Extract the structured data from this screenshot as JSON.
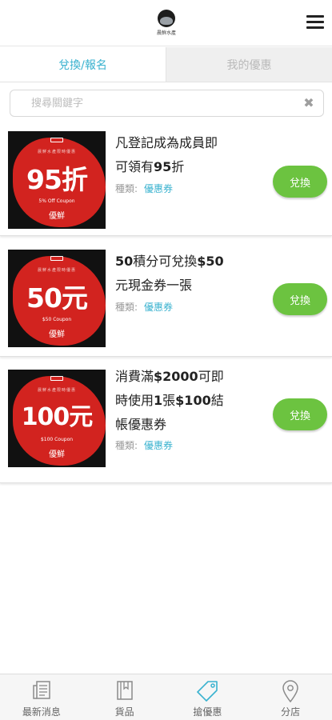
{
  "header": {
    "logo_text": "晨鮮水產",
    "menu_icon": "hamburger-icon"
  },
  "tabs": [
    {
      "label": "兌換/報名",
      "active": true
    },
    {
      "label": "我的優惠",
      "active": false
    }
  ],
  "search": {
    "placeholder": "搜尋關鍵字",
    "value": ""
  },
  "coupons": [
    {
      "image": {
        "sub": "晨鮮水產限時優惠",
        "big": "95折",
        "coupon": "5% Off Coupon",
        "brand": "優鮮"
      },
      "title": [
        "凡登記成為成員即",
        "可領有",
        "95",
        "折"
      ],
      "type_label": "種類:",
      "type_value": "優惠券",
      "button": "兌換"
    },
    {
      "image": {
        "sub": "晨鮮水產限時優惠",
        "big": "50元",
        "coupon": "$50 Coupon",
        "brand": "優鮮"
      },
      "title": [
        "50",
        "積分可兌換",
        "$50",
        "元現金券一張"
      ],
      "type_label": "種類:",
      "type_value": "優惠券",
      "button": "兌換"
    },
    {
      "image": {
        "sub": "晨鮮水產限時優惠",
        "big": "100元",
        "coupon": "$100 Coupon",
        "brand": "優鮮"
      },
      "title": [
        "消費滿",
        "$2000",
        "可即",
        "時使用",
        "1",
        "張",
        "$100",
        "結",
        "帳優惠券"
      ],
      "type_label": "種類:",
      "type_value": "優惠券",
      "button": "兌換"
    }
  ],
  "bottom_nav": [
    {
      "label": "最新消息",
      "icon": "newspaper-icon",
      "active": false
    },
    {
      "label": "貨品",
      "icon": "book-icon",
      "active": false
    },
    {
      "label": "搶優惠",
      "icon": "tag-icon",
      "active": true
    },
    {
      "label": "分店",
      "icon": "map-pin-icon",
      "active": false
    }
  ],
  "colors": {
    "accent": "#39b2cf",
    "button": "#6cc340",
    "coupon_red": "#d2231f"
  }
}
